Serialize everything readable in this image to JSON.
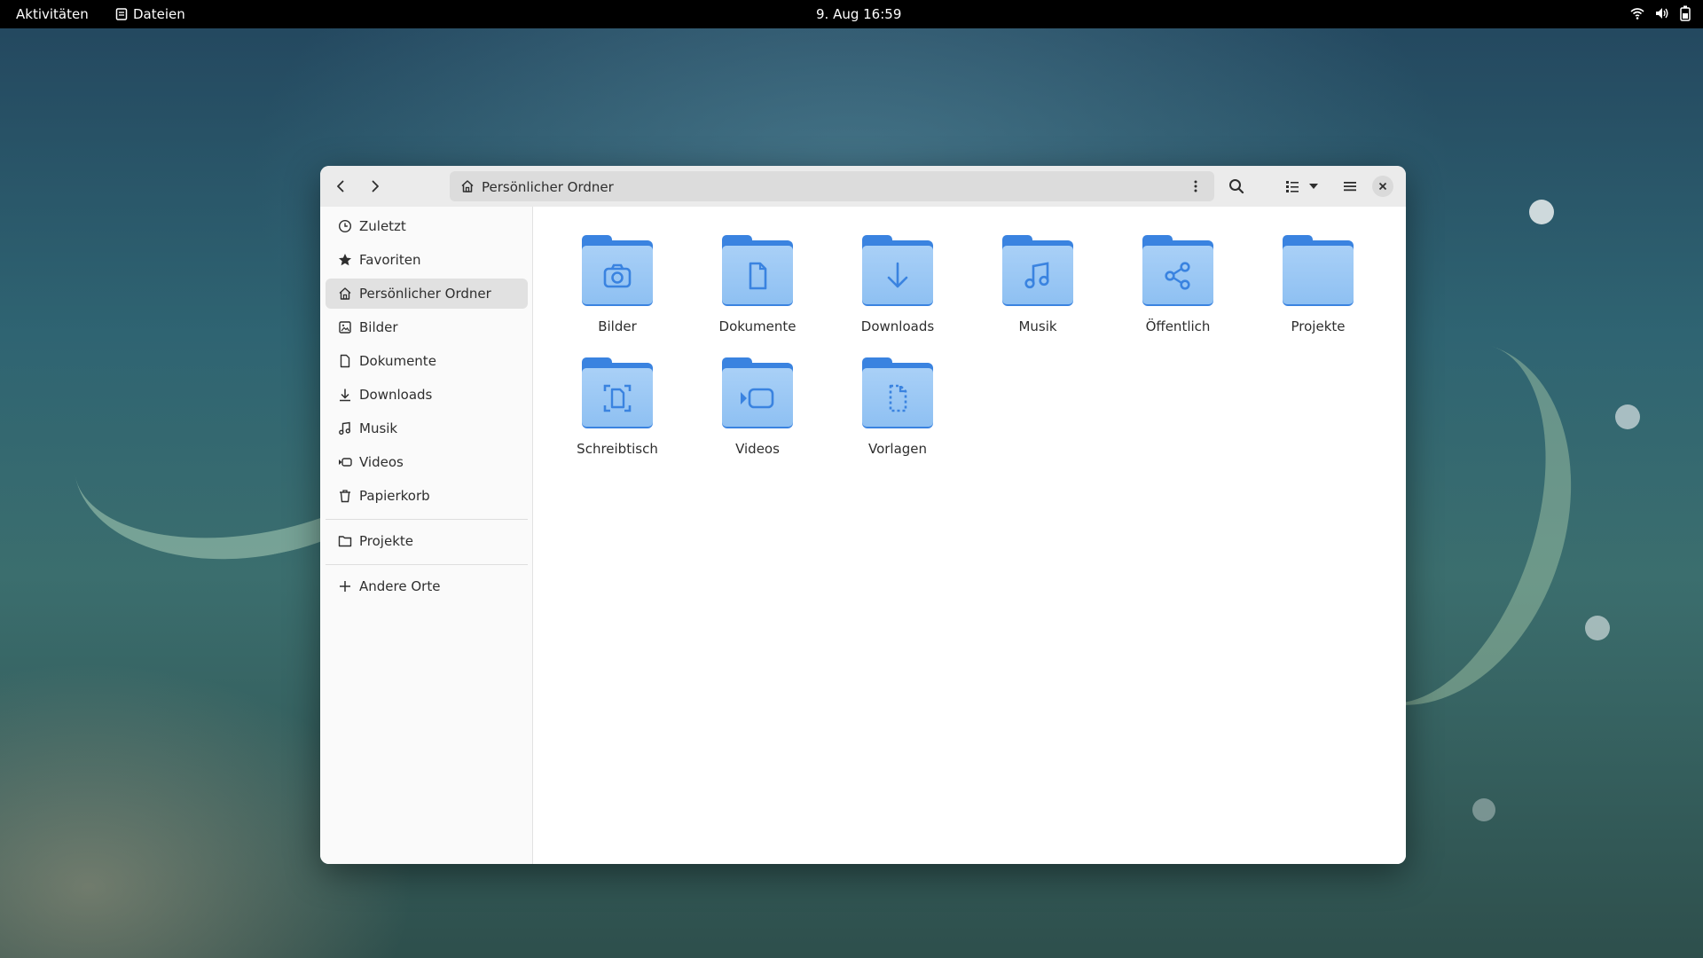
{
  "topbar": {
    "activities": "Aktivitäten",
    "app_name": "Dateien",
    "app_icon": "files-app-icon",
    "clock": "9. Aug  16:59",
    "tray_icons": [
      "wifi-icon",
      "volume-icon",
      "battery-icon"
    ]
  },
  "window": {
    "path": {
      "label": "Persönlicher Ordner",
      "icon": "home-icon"
    },
    "toolbar_icons": [
      "back-icon",
      "forward-icon",
      "kebab-menu-icon",
      "search-icon",
      "list-view-icon",
      "view-options-icon",
      "hamburger-menu-icon",
      "close-icon"
    ]
  },
  "sidebar": {
    "items": [
      {
        "label": "Zuletzt",
        "icon": "clock-icon"
      },
      {
        "label": "Favoriten",
        "icon": "star-icon"
      },
      {
        "label": "Persönlicher Ordner",
        "icon": "home-icon",
        "active": true
      },
      {
        "label": "Bilder",
        "icon": "image-icon"
      },
      {
        "label": "Dokumente",
        "icon": "document-icon"
      },
      {
        "label": "Downloads",
        "icon": "download-icon"
      },
      {
        "label": "Musik",
        "icon": "music-icon"
      },
      {
        "label": "Videos",
        "icon": "video-icon"
      },
      {
        "label": "Papierkorb",
        "icon": "trash-icon"
      }
    ],
    "bookmarks": [
      {
        "label": "Projekte",
        "icon": "folder-icon"
      }
    ],
    "other": {
      "label": "Andere Orte",
      "icon": "plus-icon"
    }
  },
  "folders": [
    {
      "name": "Bilder",
      "emblem": "camera-icon"
    },
    {
      "name": "Dokumente",
      "emblem": "document-icon"
    },
    {
      "name": "Downloads",
      "emblem": "download-icon"
    },
    {
      "name": "Musik",
      "emblem": "music-icon"
    },
    {
      "name": "Öffentlich",
      "emblem": "share-icon"
    },
    {
      "name": "Projekte",
      "emblem": ""
    },
    {
      "name": "Schreibtisch",
      "emblem": "desktop-icon"
    },
    {
      "name": "Videos",
      "emblem": "video-icon"
    },
    {
      "name": "Vorlagen",
      "emblem": "template-icon"
    }
  ],
  "colors": {
    "folder_blue": "#3a83e0",
    "folder_front": "#a9d0f7",
    "sidebar_active": "#e1e1e1",
    "topbar": "#000000"
  }
}
